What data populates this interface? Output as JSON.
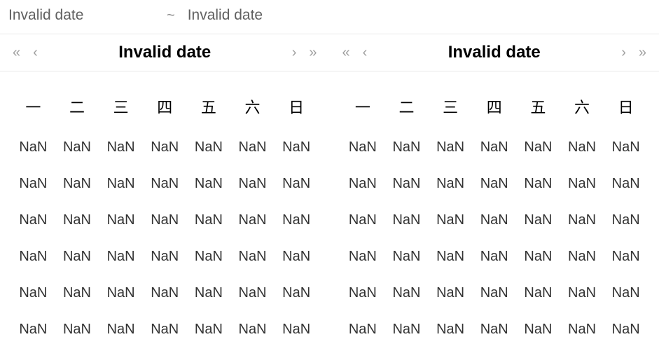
{
  "input": {
    "start": "Invalid date",
    "separator": "~",
    "end": "Invalid date"
  },
  "left": {
    "title": "Invalid date",
    "weekdays": [
      "一",
      "二",
      "三",
      "四",
      "五",
      "六",
      "日"
    ],
    "cells": [
      [
        "NaN",
        "NaN",
        "NaN",
        "NaN",
        "NaN",
        "NaN",
        "NaN"
      ],
      [
        "NaN",
        "NaN",
        "NaN",
        "NaN",
        "NaN",
        "NaN",
        "NaN"
      ],
      [
        "NaN",
        "NaN",
        "NaN",
        "NaN",
        "NaN",
        "NaN",
        "NaN"
      ],
      [
        "NaN",
        "NaN",
        "NaN",
        "NaN",
        "NaN",
        "NaN",
        "NaN"
      ],
      [
        "NaN",
        "NaN",
        "NaN",
        "NaN",
        "NaN",
        "NaN",
        "NaN"
      ],
      [
        "NaN",
        "NaN",
        "NaN",
        "NaN",
        "NaN",
        "NaN",
        "NaN"
      ]
    ]
  },
  "right": {
    "title": "Invalid date",
    "weekdays": [
      "一",
      "二",
      "三",
      "四",
      "五",
      "六",
      "日"
    ],
    "cells": [
      [
        "NaN",
        "NaN",
        "NaN",
        "NaN",
        "NaN",
        "NaN",
        "NaN"
      ],
      [
        "NaN",
        "NaN",
        "NaN",
        "NaN",
        "NaN",
        "NaN",
        "NaN"
      ],
      [
        "NaN",
        "NaN",
        "NaN",
        "NaN",
        "NaN",
        "NaN",
        "NaN"
      ],
      [
        "NaN",
        "NaN",
        "NaN",
        "NaN",
        "NaN",
        "NaN",
        "NaN"
      ],
      [
        "NaN",
        "NaN",
        "NaN",
        "NaN",
        "NaN",
        "NaN",
        "NaN"
      ],
      [
        "NaN",
        "NaN",
        "NaN",
        "NaN",
        "NaN",
        "NaN",
        "NaN"
      ]
    ]
  },
  "nav": {
    "prev_year": "«",
    "prev_month": "‹",
    "next_month": "›",
    "next_year": "»"
  }
}
